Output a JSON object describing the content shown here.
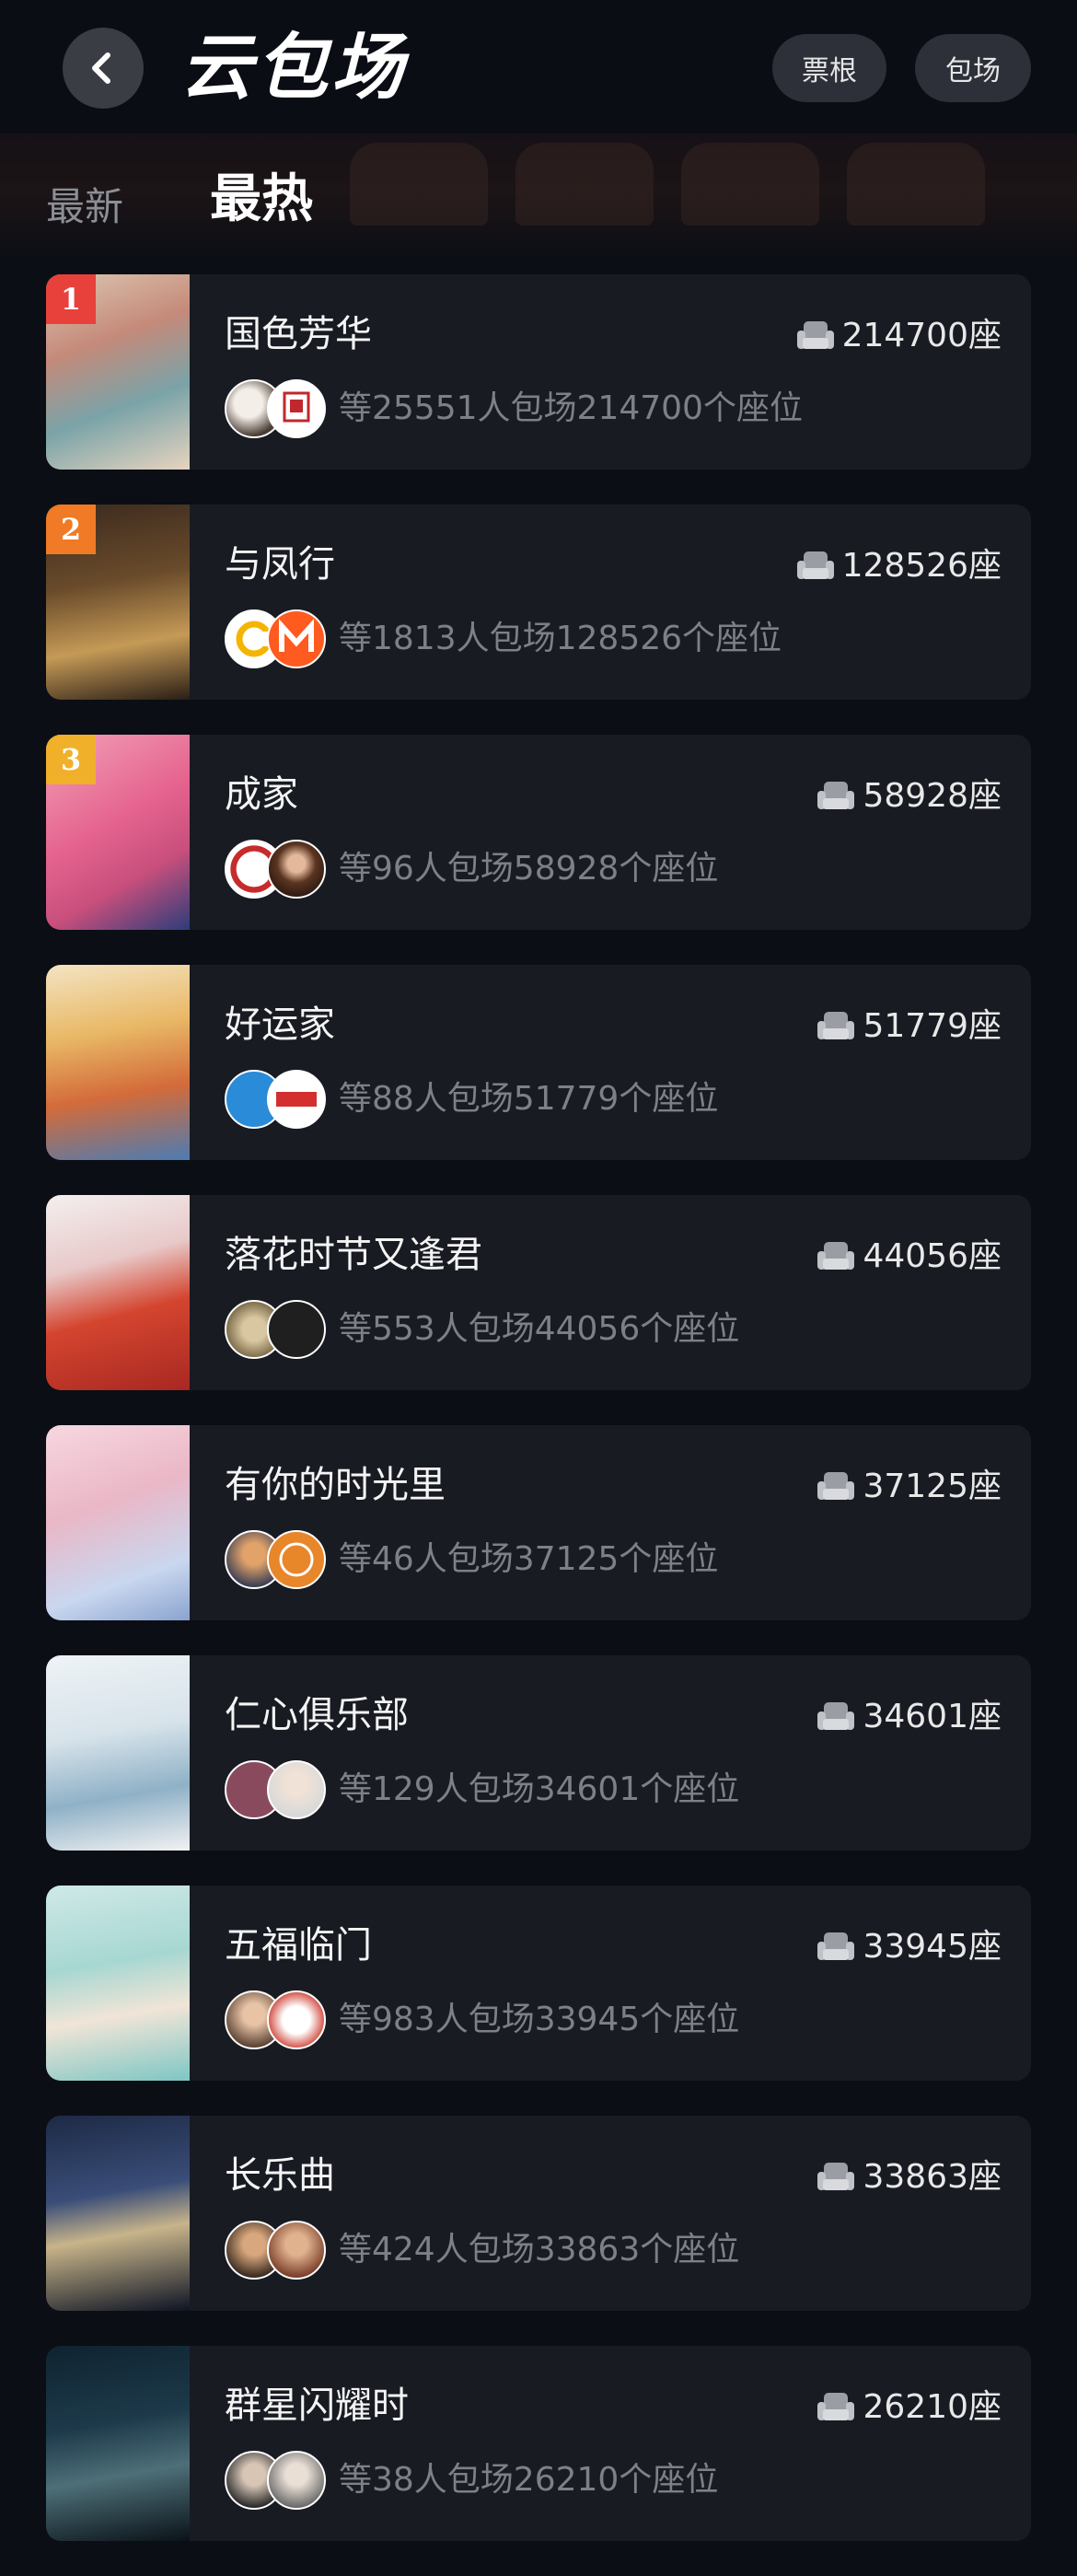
{
  "header": {
    "title": "云包场",
    "ticket_label": "票根",
    "venue_label": "包场"
  },
  "tabs": {
    "latest": "最新",
    "hottest": "最热"
  },
  "items": [
    {
      "rank": "1",
      "title": "国色芳华",
      "seats": "214700座",
      "desc": "等25551人包场214700个座位",
      "rank_color": "#e8413b"
    },
    {
      "rank": "2",
      "title": "与凤行",
      "seats": "128526座",
      "desc": "等1813人包场128526个座位",
      "rank_color": "#f07a25"
    },
    {
      "rank": "3",
      "title": "成家",
      "seats": "58928座",
      "desc": "等96人包场58928个座位",
      "rank_color": "#f0b02a"
    },
    {
      "rank": "",
      "title": "好运家",
      "seats": "51779座",
      "desc": "等88人包场51779个座位"
    },
    {
      "rank": "",
      "title": "落花时节又逢君",
      "seats": "44056座",
      "desc": "等553人包场44056个座位"
    },
    {
      "rank": "",
      "title": "有你的时光里",
      "seats": "37125座",
      "desc": "等46人包场37125个座位"
    },
    {
      "rank": "",
      "title": "仁心俱乐部",
      "seats": "34601座",
      "desc": "等129人包场34601个座位"
    },
    {
      "rank": "",
      "title": "五福临门",
      "seats": "33945座",
      "desc": "等983人包场33945个座位"
    },
    {
      "rank": "",
      "title": "长乐曲",
      "seats": "33863座",
      "desc": "等424人包场33863个座位"
    },
    {
      "rank": "",
      "title": "群星闪耀时",
      "seats": "26210座",
      "desc": "等38人包场26210个座位"
    }
  ],
  "colors": {
    "background": "#0b0e14",
    "card": "#181b22",
    "desc_text": "#7d8087"
  }
}
